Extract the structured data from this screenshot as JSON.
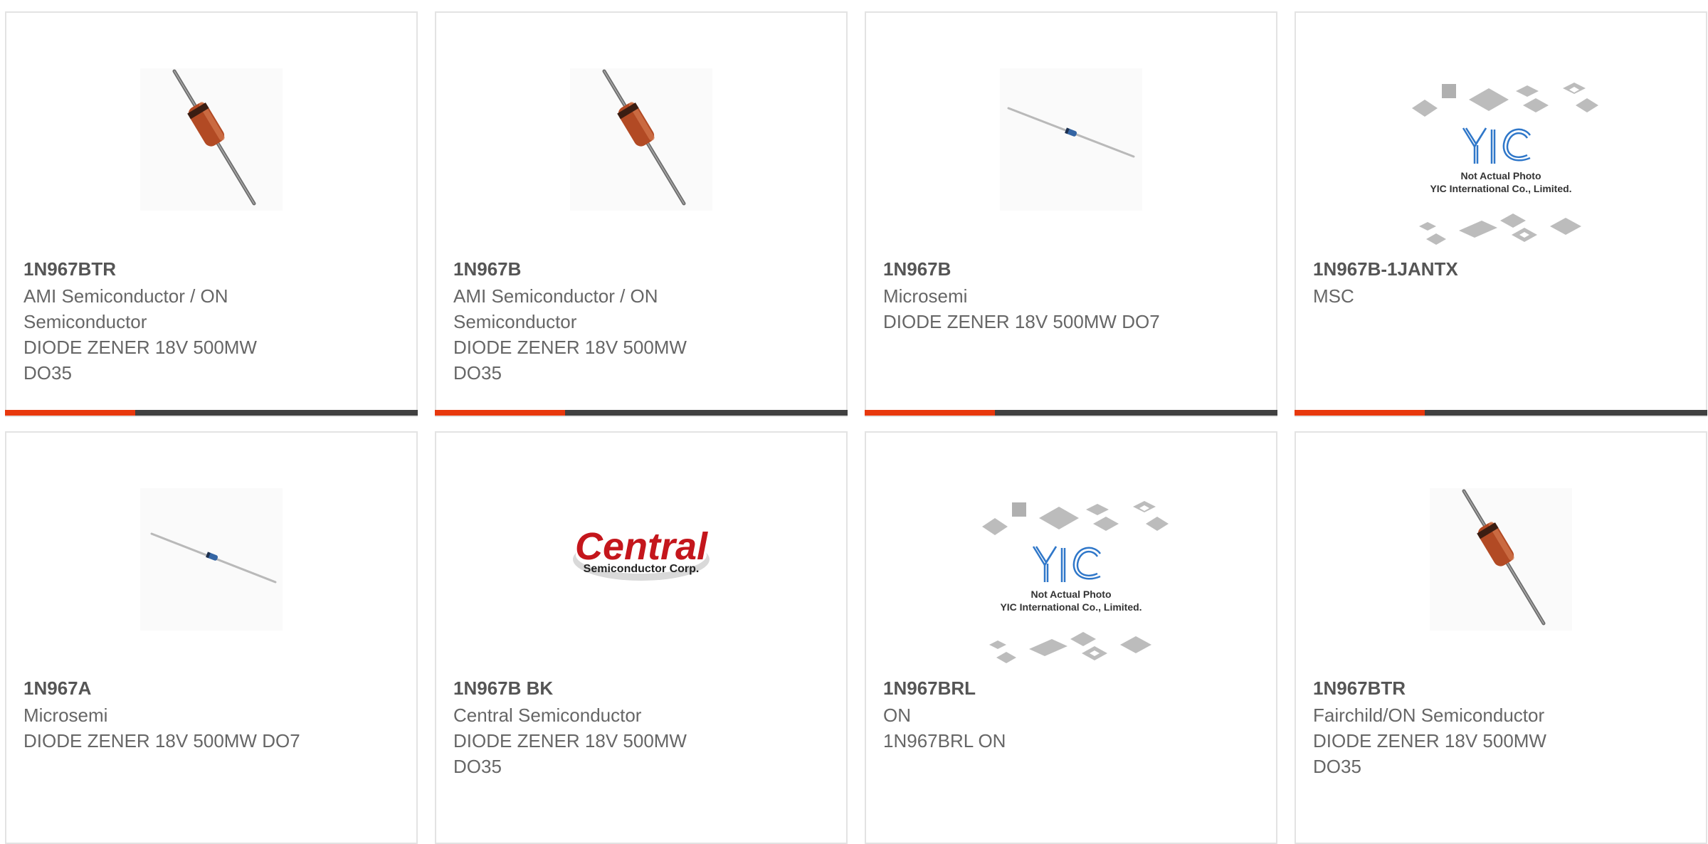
{
  "colors": {
    "accent": "#e8380d",
    "bar_dark": "#404040",
    "card_border": "#e3e3e3",
    "text": "#666666",
    "part_text": "#555555"
  },
  "products": [
    {
      "part": "1N967BTR",
      "manufacturer": "AMI Semiconductor / ON Semiconductor",
      "description": "DIODE ZENER 18V 500MW DO35",
      "image": "diode-photo"
    },
    {
      "part": "1N967B",
      "manufacturer": "AMI Semiconductor / ON Semiconductor",
      "description": "DIODE ZENER 18V 500MW DO35",
      "image": "diode-photo"
    },
    {
      "part": "1N967B",
      "manufacturer": "Microsemi",
      "description": "DIODE ZENER 18V 500MW DO7",
      "image": "axial-diode-photo"
    },
    {
      "part": "1N967B-1JANTX",
      "manufacturer": "MSC",
      "description": "",
      "image": "yic-placeholder",
      "placeholder_text": [
        "Not Actual Photo",
        "YIC International Co., Limited."
      ]
    },
    {
      "part": "1N967A",
      "manufacturer": "Microsemi",
      "description": "DIODE ZENER 18V 500MW DO7",
      "image": "axial-diode-photo"
    },
    {
      "part": "1N967B BK",
      "manufacturer": "Central Semiconductor",
      "description": "DIODE ZENER 18V 500MW DO35",
      "image": "central-logo",
      "logo_text": [
        "Central",
        "Semiconductor Corp."
      ]
    },
    {
      "part": "1N967BRL",
      "manufacturer": "ON",
      "description": "1N967BRL ON",
      "image": "yic-placeholder",
      "placeholder_text": [
        "Not Actual Photo",
        "YIC International Co., Limited."
      ]
    },
    {
      "part": "1N967BTR",
      "manufacturer": "Fairchild/ON Semiconductor",
      "description": "DIODE ZENER 18V 500MW DO35",
      "image": "diode-photo"
    }
  ]
}
